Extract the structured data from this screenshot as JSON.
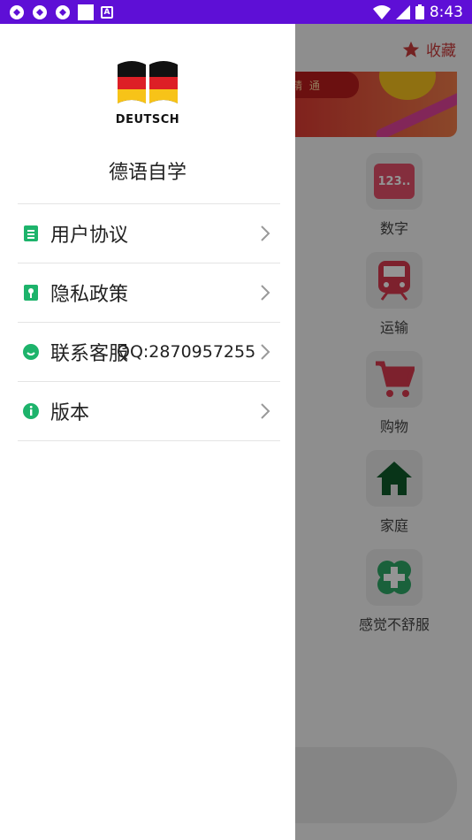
{
  "status_bar": {
    "time": "8:43"
  },
  "background": {
    "favorites_label": "收藏",
    "banner_text": "精 通",
    "categories": [
      {
        "icon": "123-icon",
        "label": "数字"
      },
      {
        "icon": "train-icon",
        "label": "运输"
      },
      {
        "icon": "cart-icon",
        "label": "购物"
      },
      {
        "icon": "home-icon",
        "label": "家庭"
      },
      {
        "icon": "clover-cross-icon",
        "label": "感觉不舒服"
      }
    ],
    "number_icon_text": "123.."
  },
  "drawer": {
    "logo_text": "DEUTSCH",
    "app_name": "德语自学",
    "menu": [
      {
        "label": "用户协议",
        "icon": "document-icon",
        "extra": ""
      },
      {
        "label": "隐私政策",
        "icon": "key-icon",
        "extra": ""
      },
      {
        "label": "联系客服",
        "icon": "chat-icon",
        "extra": "QQ:2870957255"
      },
      {
        "label": "版本",
        "icon": "info-icon",
        "extra": ""
      }
    ]
  },
  "colors": {
    "status_bar": "#5e0fd6",
    "accent_green": "#1db36b",
    "favorite_red": "#c93b3b"
  }
}
